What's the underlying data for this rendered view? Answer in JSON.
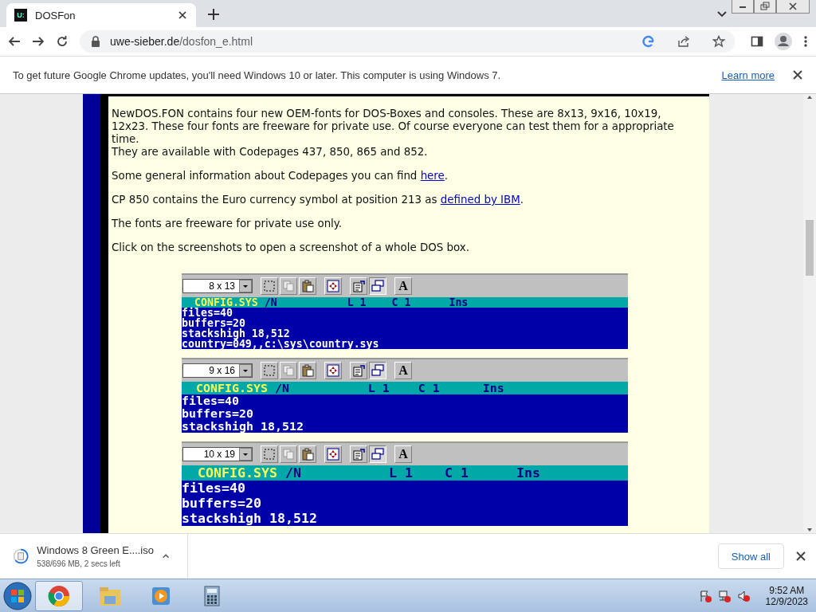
{
  "tab": {
    "favicon_text": "U:",
    "title": "DOSFon",
    "selected": true
  },
  "address": {
    "host": "uwe-sieber.de",
    "path": "/dosfon_e.html"
  },
  "infobar": {
    "text": "To get future Google Chrome updates, you'll need Windows 10 or later. This computer is using Windows 7.",
    "link": "Learn more"
  },
  "paragraphs": [
    {
      "lines": [
        [
          {
            "text": "NewDOS.FON contains four new OEM-fonts for DOS-Boxes and consoles. These are 8x13, 9x16, 10x19, 12x23. These four fonts are freeware for private use. Of course everyone can test them for a appropriate time."
          }
        ],
        [
          {
            "text": "They are available with Codepages 437, 850, 865 and 852."
          }
        ]
      ]
    },
    {
      "lines": [
        [
          {
            "text": "Some general information about Codepages you can find "
          },
          {
            "link": "here"
          },
          {
            "text": "."
          }
        ]
      ]
    },
    {
      "lines": [
        [
          {
            "text": "CP 850 contains the Euro currency symbol at position 213 as "
          },
          {
            "link": "defined by IBM"
          },
          {
            "text": "."
          }
        ]
      ]
    },
    {
      "lines": [
        [
          {
            "text": "The fonts are freeware for private use only."
          }
        ]
      ]
    },
    {
      "lines": [
        [
          {
            "text": "Click on the screenshots to open a screenshot of a whole DOS box."
          }
        ]
      ]
    }
  ],
  "screenshots": [
    {
      "kind": "small",
      "size": "8 x 13",
      "font_button": "A",
      "title": {
        "file": "CONFIG.SYS",
        "flag": "/N",
        "line": "L 1",
        "col": "C 1",
        "mode": "Ins"
      },
      "lines": [
        "files=40",
        "buffers=20",
        "stackshigh 18,512",
        "country=049,,c:\\sys\\country.sys"
      ]
    },
    {
      "kind": "medium",
      "size": "9 x 16",
      "font_button": "A",
      "title": {
        "file": "CONFIG.SYS",
        "flag": "/N",
        "line": "L 1",
        "col": "C 1",
        "mode": "Ins"
      },
      "lines": [
        "files=40",
        "buffers=20",
        "stackshigh 18,512"
      ]
    },
    {
      "kind": "large",
      "size": "10 x 19",
      "font_button": "A",
      "title": {
        "file": "CONFIG.SYS",
        "flag": "/N",
        "line": "L 1",
        "col": "C 1",
        "mode": "Ins"
      },
      "lines": [
        "files=40",
        "buffers=20",
        "stackshigh 18,512"
      ]
    }
  ],
  "download": {
    "name": "Windows 8 Green E....iso",
    "status": "538/696 MB, 2 secs left",
    "show_all": "Show all"
  },
  "taskbar": {
    "apps": [
      {
        "kind": "chrome",
        "selected": true
      },
      {
        "kind": "explorer",
        "selected": false
      },
      {
        "kind": "media",
        "selected": false
      },
      {
        "kind": "calculator",
        "selected": false
      }
    ],
    "time": "9:52 AM",
    "date": "12/9/2023"
  }
}
